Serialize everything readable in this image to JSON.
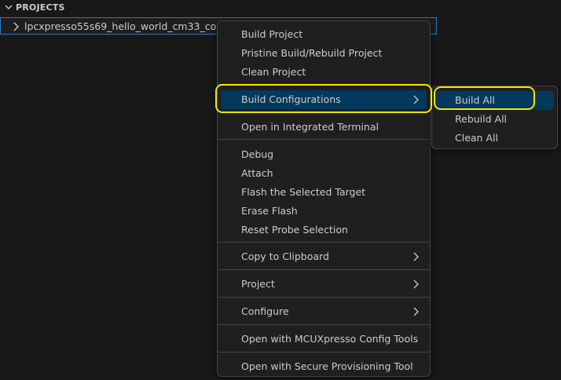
{
  "explorer": {
    "section_title": "PROJECTS",
    "project_name": "lpcxpresso55s69_hello_world_cm33_core0"
  },
  "context_menu": {
    "items": [
      {
        "label": "Build Project"
      },
      {
        "label": "Pristine Build/Rebuild Project"
      },
      {
        "label": "Clean Project"
      },
      {
        "label": "Build Configurations"
      },
      {
        "label": "Open in Integrated Terminal"
      },
      {
        "label": "Debug"
      },
      {
        "label": "Attach"
      },
      {
        "label": "Flash the Selected Target"
      },
      {
        "label": "Erase Flash"
      },
      {
        "label": "Reset Probe Selection"
      },
      {
        "label": "Copy to Clipboard"
      },
      {
        "label": "Project"
      },
      {
        "label": "Configure"
      },
      {
        "label": "Open with MCUXpresso Config Tools"
      },
      {
        "label": "Open with Secure Provisioning Tool"
      }
    ]
  },
  "submenu": {
    "items": [
      {
        "label": "Build All"
      },
      {
        "label": "Rebuild All"
      },
      {
        "label": "Clean All"
      }
    ]
  },
  "colors": {
    "background": "#181818",
    "menu_background": "#1f1f1f",
    "active_item": "#04395e",
    "highlight_outline": "#f2e600",
    "selection_border": "#2b79c2"
  }
}
